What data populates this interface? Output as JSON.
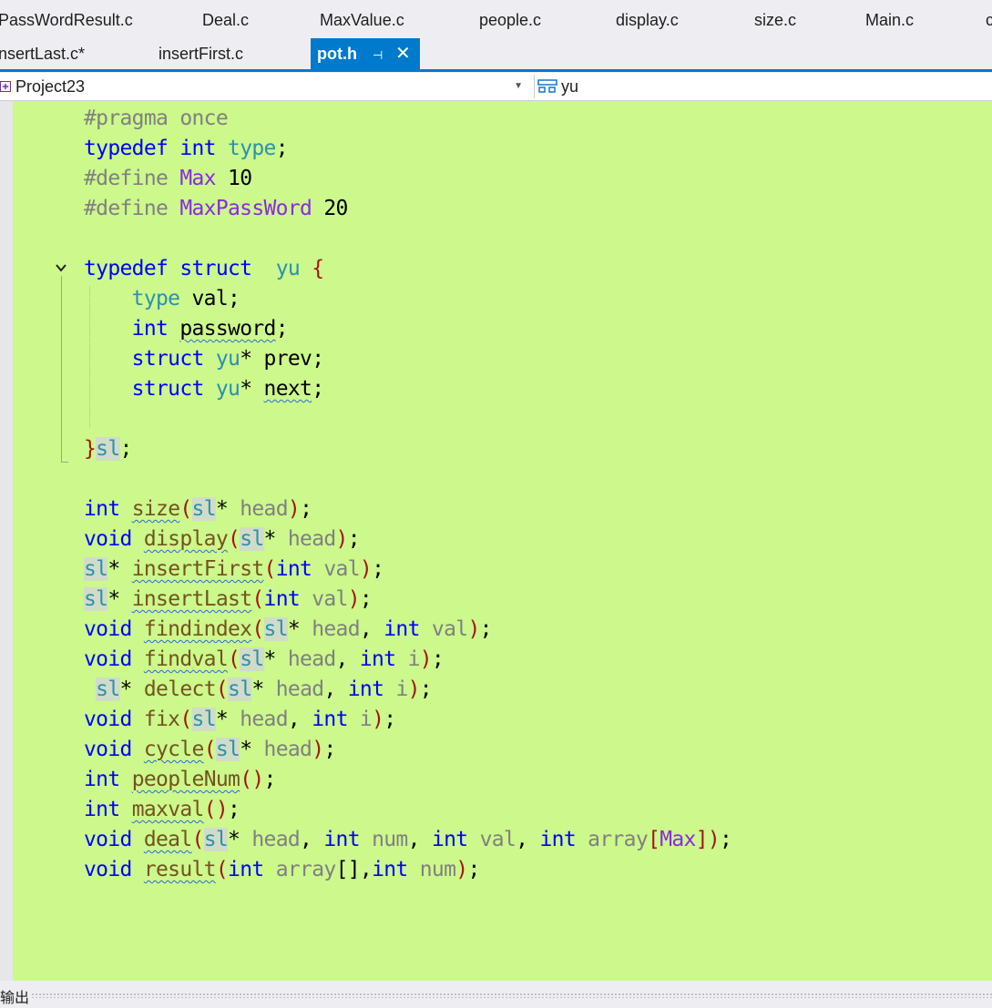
{
  "tabs_row1": [
    "PassWordResult.c",
    "Deal.c",
    "MaxValue.c",
    "people.c",
    "display.c",
    "size.c",
    "Main.c",
    "c"
  ],
  "tabs_row2": [
    "insertLast.c*",
    "insertFirst.c"
  ],
  "active_tab": {
    "label": "pot.h",
    "pin_glyph": "⊣",
    "close_glyph": "✕"
  },
  "nav": {
    "project": "Project23",
    "scope": "yu",
    "scope_icon": "struct-icon"
  },
  "code": {
    "line1": {
      "a": "#pragma",
      "b": "once"
    },
    "line2": {
      "a": "typedef",
      "b": "int",
      "c": "type",
      "d": ";"
    },
    "line3": {
      "a": "#define",
      "b": "Max",
      "c": "10"
    },
    "line4": {
      "a": "#define",
      "b": "MaxPassWord",
      "c": "20"
    },
    "line6": {
      "a": "typedef",
      "b": "struct",
      "c": "yu",
      "d": "{"
    },
    "line7": {
      "a": "type",
      "b": "val;"
    },
    "line8": {
      "a": "int",
      "b": "password",
      "c": ";"
    },
    "line9": {
      "a": "struct",
      "b": "yu",
      "c": "* prev;"
    },
    "line10": {
      "a": "struct",
      "b": "yu",
      "c": "* ",
      "d": "next",
      "e": ";"
    },
    "line12": {
      "a": "}",
      "b": "sl",
      "c": ";"
    },
    "line14": {
      "a": "int",
      "b": "size",
      "c": "(",
      "d": "sl",
      "e": "* ",
      "f": "head",
      "g": ")",
      "h": ";"
    },
    "line15": {
      "a": "void",
      "b": "display",
      "c": "(",
      "d": "sl",
      "e": "* ",
      "f": "head",
      "g": ")",
      "h": ";"
    },
    "line16": {
      "a": "sl",
      "b": "* ",
      "c": "insertFirst",
      "d": "(",
      "e": "int",
      "f": "val",
      "g": ")",
      "h": ";"
    },
    "line17": {
      "a": "sl",
      "b": "* ",
      "c": "insertLast",
      "d": "(",
      "e": "int",
      "f": "val",
      "g": ")",
      "h": ";"
    },
    "line18": {
      "a": "void",
      "b": "findindex",
      "c": "(",
      "d": "sl",
      "e": "* ",
      "f": "head",
      "g": ", ",
      "h": "int",
      "i": "val",
      "j": ")",
      "k": ";"
    },
    "line19": {
      "a": "void",
      "b": "findval",
      "c": "(",
      "d": "sl",
      "e": "* ",
      "f": "head",
      "g": ", ",
      "h": "int",
      "i": "i",
      "j": ")",
      "k": ";"
    },
    "line20": {
      "a": "sl",
      "b": "* ",
      "c": "delect",
      "d": "(",
      "e": "sl",
      "f": "* ",
      "g": "head",
      "h": ", ",
      "i": "int",
      "j": "i",
      "k": ")",
      "l": ";"
    },
    "line21": {
      "a": "void",
      "b": "fix",
      "c": "(",
      "d": "sl",
      "e": "* ",
      "f": "head",
      "g": ", ",
      "h": "int",
      "i": "i",
      "j": ")",
      "k": ";"
    },
    "line22": {
      "a": "void",
      "b": "cycle",
      "c": "(",
      "d": "sl",
      "e": "* ",
      "f": "head",
      "g": ")",
      "h": ";"
    },
    "line23": {
      "a": "int",
      "b": "peopleNum",
      "c": "()",
      "d": ";"
    },
    "line24": {
      "a": "int",
      "b": "maxval",
      "c": "()",
      "d": ";"
    },
    "line25": {
      "a": "void",
      "b": "deal",
      "c": "(",
      "d": "sl",
      "e": "* ",
      "f": "head",
      "g": ", ",
      "h": "int",
      "i": "num",
      "j": ", ",
      "k": "int",
      "l": "val",
      "m": ", ",
      "n": "int",
      "o": "array",
      "p": "[",
      "q": "Max",
      "r": "]",
      "s": ")",
      "t": ";"
    },
    "line26": {
      "a": "void",
      "b": "result",
      "c": "(",
      "d": "int",
      "e": "array",
      "f": "[],",
      "g": "int",
      "h": "num",
      "i": ")",
      "j": ";"
    }
  },
  "output_panel": {
    "label": "输出"
  },
  "colors": {
    "editor_bg": "#ccf88c",
    "accent": "#007acc",
    "keyword": "#0000ff",
    "type": "#2b91af"
  }
}
